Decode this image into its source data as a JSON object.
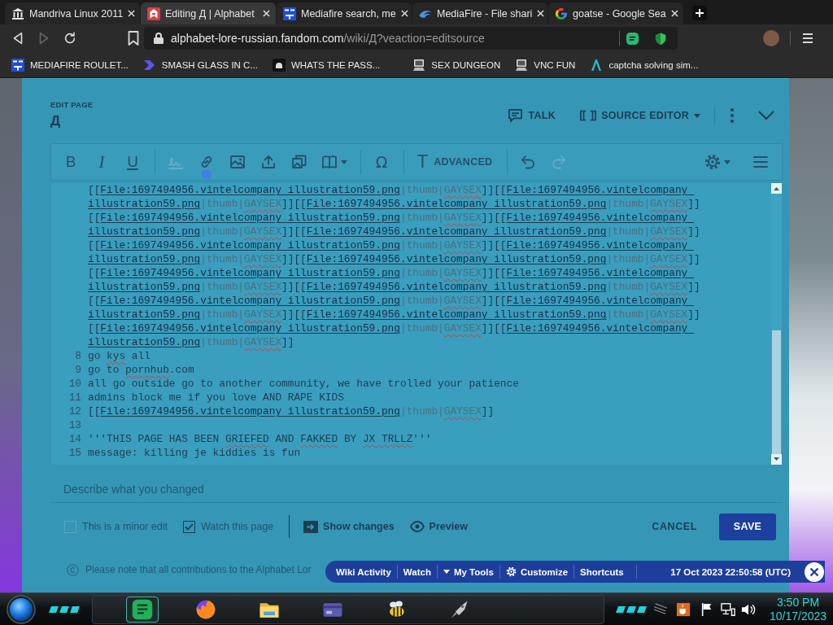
{
  "browser": {
    "tabs": [
      {
        "title": "Mandriva Linux 2011",
        "selected": false
      },
      {
        "title": "Editing Д | Alphabet",
        "selected": true
      },
      {
        "title": "Mediafire search, me",
        "selected": false
      },
      {
        "title": "MediaFire - File shari",
        "selected": false
      },
      {
        "title": "goatse - Google Sea",
        "selected": false
      }
    ],
    "nav": [
      {
        "kind": "back",
        "disabled": false
      },
      {
        "kind": "forward",
        "disabled": true
      },
      {
        "kind": "reload",
        "disabled": false
      }
    ],
    "address": {
      "host": "alphabet-lore-russian.fandom.com",
      "path": "/wiki/Д?veaction=editsource"
    },
    "bookmarks": [
      "MEDIAFIRE ROULET...",
      "SMASH GLASS IN C...",
      "WHATS THE PASS...",
      "SEX DUNGEON",
      "VNC FUN",
      "captcha solving sim..."
    ]
  },
  "editor": {
    "label": "EDIT PAGE",
    "title": "Д",
    "talk": "TALK",
    "mode": "SOURCE EDITOR",
    "toolbar": {
      "groups": [
        {
          "tools": [
            {
              "kind": "bold",
              "label": "B",
              "disabled": false
            },
            {
              "kind": "italic",
              "label": "I",
              "disabled": false
            },
            {
              "kind": "underline",
              "label": "U",
              "disabled": false
            }
          ]
        },
        {
          "tools": [
            {
              "kind": "signature",
              "disabled": true
            },
            {
              "kind": "link",
              "disabled": false
            },
            {
              "kind": "image",
              "disabled": false
            },
            {
              "kind": "upload",
              "disabled": false
            },
            {
              "kind": "gallery",
              "disabled": false
            },
            {
              "kind": "cite",
              "disabled": false
            }
          ]
        },
        {
          "tools": [
            {
              "kind": "special",
              "label": "Ω",
              "disabled": false
            }
          ]
        },
        {
          "tools": [
            {
              "kind": "advanced",
              "glyph": "T",
              "label": "ADVANCED",
              "disabled": false
            }
          ]
        },
        {
          "tools": [
            {
              "kind": "undo",
              "disabled": false
            },
            {
              "kind": "redo",
              "disabled": true
            }
          ]
        }
      ],
      "end": [
        {
          "kind": "settings",
          "disabled": false
        },
        {
          "kind": "menu",
          "disabled": false
        }
      ]
    },
    "code": {
      "lines": [
        {
          "segments": [
            {
              "kind": "bracket",
              "text": "[[",
              "misspelled": false
            },
            {
              "kind": "link",
              "text": "File:1697494956.vintelcompany illustration59.png",
              "misspelled": false
            },
            {
              "kind": "param",
              "text": "|thumb|",
              "misspelled": false
            },
            {
              "kind": "param",
              "text": "GAYSEX",
              "misspelled": true
            },
            {
              "kind": "bracket",
              "text": "]]",
              "misspelled": false
            },
            {
              "kind": "bracket",
              "text": "[[",
              "misspelled": false
            },
            {
              "kind": "link",
              "text": "File:1697494956.vintelcompany illustration59.png",
              "misspelled": false
            },
            {
              "kind": "param",
              "text": "|thumb|",
              "misspelled": false
            },
            {
              "kind": "param",
              "text": "GAYSEX",
              "misspelled": true
            },
            {
              "kind": "bracket",
              "text": "]]",
              "misspelled": false
            },
            {
              "kind": "bracket",
              "text": "[[",
              "misspelled": false
            },
            {
              "kind": "link",
              "text": "File:1697494956.vintelcompany illustration59.png",
              "misspelled": false
            },
            {
              "kind": "param",
              "text": "|thumb|",
              "misspelled": false
            },
            {
              "kind": "param",
              "text": "GAYSEX",
              "misspelled": true
            },
            {
              "kind": "bracket",
              "text": "]]",
              "misspelled": false
            },
            {
              "kind": "bracket",
              "text": "[[",
              "misspelled": false
            },
            {
              "kind": "link",
              "text": "File:1697494956.vintelcompany illustration59.png",
              "misspelled": false
            },
            {
              "kind": "param",
              "text": "|thumb|",
              "misspelled": false
            },
            {
              "kind": "param",
              "text": "GAYSEX",
              "misspelled": true
            },
            {
              "kind": "bracket",
              "text": "]]",
              "misspelled": false
            },
            {
              "kind": "bracket",
              "text": "[[",
              "misspelled": false
            },
            {
              "kind": "link",
              "text": "File:1697494956.vintelcompany illustration59.png",
              "misspelled": false
            },
            {
              "kind": "param",
              "text": "|thumb|",
              "misspelled": false
            },
            {
              "kind": "param",
              "text": "GAYSEX",
              "misspelled": true
            },
            {
              "kind": "bracket",
              "text": "]]",
              "misspelled": false
            },
            {
              "kind": "bracket",
              "text": "[[",
              "misspelled": false
            },
            {
              "kind": "link",
              "text": "File:1697494956.vintelcompany illustration59.png",
              "misspelled": false
            },
            {
              "kind": "param",
              "text": "|thumb|",
              "misspelled": false
            },
            {
              "kind": "param",
              "text": "GAYSEX",
              "misspelled": true
            },
            {
              "kind": "bracket",
              "text": "]]",
              "misspelled": false
            },
            {
              "kind": "bracket",
              "text": "[[",
              "misspelled": false
            },
            {
              "kind": "link",
              "text": "File:1697494956.vintelcompany illustration59.png",
              "misspelled": false
            },
            {
              "kind": "param",
              "text": "|thumb|",
              "misspelled": false
            },
            {
              "kind": "param",
              "text": "GAYSEX",
              "misspelled": true
            },
            {
              "kind": "bracket",
              "text": "]]",
              "misspelled": false
            },
            {
              "kind": "bracket",
              "text": "[[",
              "misspelled": false
            },
            {
              "kind": "link",
              "text": "File:1697494956.vintelcompany illustration59.png",
              "misspelled": false
            },
            {
              "kind": "param",
              "text": "|thumb|",
              "misspelled": false
            },
            {
              "kind": "param",
              "text": "GAYSEX",
              "misspelled": true
            },
            {
              "kind": "bracket",
              "text": "]]",
              "misspelled": false
            },
            {
              "kind": "bracket",
              "text": "[[",
              "misspelled": false
            },
            {
              "kind": "link",
              "text": "File:1697494956.vintelcompany illustration59.png",
              "misspelled": false
            },
            {
              "kind": "param",
              "text": "|thumb|",
              "misspelled": false
            },
            {
              "kind": "param",
              "text": "GAYSEX",
              "misspelled": true
            },
            {
              "kind": "bracket",
              "text": "]]",
              "misspelled": false
            },
            {
              "kind": "bracket",
              "text": "[[",
              "misspelled": false
            },
            {
              "kind": "link",
              "text": "File:1697494956.vintelcompany illustration59.png",
              "misspelled": false
            },
            {
              "kind": "param",
              "text": "|thumb|",
              "misspelled": false
            },
            {
              "kind": "param",
              "text": "GAYSEX",
              "misspelled": true
            },
            {
              "kind": "bracket",
              "text": "]]",
              "misspelled": false
            },
            {
              "kind": "bracket",
              "text": "[[",
              "misspelled": false
            },
            {
              "kind": "link",
              "text": "File:1697494956.vintelcompany illustration59.png",
              "misspelled": false
            },
            {
              "kind": "param",
              "text": "|thumb|",
              "misspelled": false
            },
            {
              "kind": "param",
              "text": "GAYSEX",
              "misspelled": true
            },
            {
              "kind": "bracket",
              "text": "]]",
              "misspelled": false
            },
            {
              "kind": "bracket",
              "text": "[[",
              "misspelled": false
            },
            {
              "kind": "link",
              "text": "File:1697494956.vintelcompany illustration59.png",
              "misspelled": false
            },
            {
              "kind": "param",
              "text": "|thumb|",
              "misspelled": false
            },
            {
              "kind": "param",
              "text": "GAYSEX",
              "misspelled": true
            },
            {
              "kind": "bracket",
              "text": "]]",
              "misspelled": false
            },
            {
              "kind": "bracket",
              "text": "[[",
              "misspelled": false
            },
            {
              "kind": "link",
              "text": "File:1697494956.vintelcompany illustration59.png",
              "misspelled": false
            },
            {
              "kind": "param",
              "text": "|thumb|",
              "misspelled": false
            },
            {
              "kind": "param",
              "text": "GAYSEX",
              "misspelled": true
            },
            {
              "kind": "bracket",
              "text": "]]",
              "misspelled": false
            },
            {
              "kind": "bracket",
              "text": "[[",
              "misspelled": false
            },
            {
              "kind": "link",
              "text": "File:1697494956.vintelcompany illustration59.png",
              "misspelled": false
            },
            {
              "kind": "param",
              "text": "|thumb|",
              "misspelled": false
            },
            {
              "kind": "param",
              "text": "GAYSEX",
              "misspelled": true
            },
            {
              "kind": "bracket",
              "text": "]]",
              "misspelled": false
            },
            {
              "kind": "bracket",
              "text": "[[",
              "misspelled": false
            },
            {
              "kind": "link",
              "text": "File:1697494956.vintelcompany illustration59.png",
              "misspelled": false
            },
            {
              "kind": "param",
              "text": "|thumb|",
              "misspelled": false
            },
            {
              "kind": "param",
              "text": "GAYSEX",
              "misspelled": true
            },
            {
              "kind": "bracket",
              "text": "]]",
              "misspelled": false
            },
            {
              "kind": "bracket",
              "text": "[[",
              "misspelled": false
            },
            {
              "kind": "link",
              "text": "File:1697494956.vintelcompany illustration59.png",
              "misspelled": false
            },
            {
              "kind": "param",
              "text": "|thumb|",
              "misspelled": false
            },
            {
              "kind": "param",
              "text": "GAYSEX",
              "misspelled": true
            },
            {
              "kind": "bracket",
              "text": "]]",
              "misspelled": false
            },
            {
              "kind": "bracket",
              "text": "[[",
              "misspelled": false
            },
            {
              "kind": "link",
              "text": "File:1697494956.vintelcompany illustration59.png",
              "misspelled": false
            },
            {
              "kind": "param",
              "text": "|thumb|",
              "misspelled": false
            },
            {
              "kind": "param",
              "text": "GAYSEX",
              "misspelled": true
            },
            {
              "kind": "bracket",
              "text": "]]",
              "misspelled": false
            }
          ]
        },
        {
          "number": "8",
          "segments": [
            {
              "kind": "plain",
              "text": "go ",
              "misspelled": false
            },
            {
              "kind": "plain",
              "text": "kys",
              "misspelled": true
            },
            {
              "kind": "plain",
              "text": " all",
              "misspelled": false
            }
          ]
        },
        {
          "number": "9",
          "segments": [
            {
              "kind": "plain",
              "text": "go to ",
              "misspelled": false
            },
            {
              "kind": "plain",
              "text": "pornhub",
              "misspelled": true
            },
            {
              "kind": "plain",
              "text": ".com",
              "misspelled": false
            }
          ]
        },
        {
          "number": "10",
          "segments": [
            {
              "kind": "plain",
              "text": "all go outside go to another community, we have trolled your patience",
              "misspelled": false
            }
          ]
        },
        {
          "number": "11",
          "segments": [
            {
              "kind": "plain",
              "text": "admins block me if you love AND RAPE KIDS",
              "misspelled": false
            }
          ]
        },
        {
          "number": "12",
          "segments": [
            {
              "kind": "bracket",
              "text": "[[",
              "misspelled": false
            },
            {
              "kind": "link",
              "text": "File:1697494956.vintelcompany illustration59.png",
              "misspelled": false
            },
            {
              "kind": "param",
              "text": "|thumb|",
              "misspelled": false
            },
            {
              "kind": "param",
              "text": "GAYSEX",
              "misspelled": true
            },
            {
              "kind": "bracket",
              "text": "]]",
              "misspelled": false
            }
          ]
        },
        {
          "number": "13"
        },
        {
          "number": "14",
          "segments": [
            {
              "kind": "plain",
              "text": "'''THIS PAGE HAS BEEN ",
              "misspelled": false
            },
            {
              "kind": "plain",
              "text": "GRIEFED",
              "misspelled": true
            },
            {
              "kind": "plain",
              "text": " AND ",
              "misspelled": false
            },
            {
              "kind": "plain",
              "text": "FAKKED",
              "misspelled": true
            },
            {
              "kind": "plain",
              "text": " BY ",
              "misspelled": false
            },
            {
              "kind": "plain",
              "text": "JX",
              "misspelled": true
            },
            {
              "kind": "plain",
              "text": " TRLLZ",
              "misspelled": true
            },
            {
              "kind": "plain",
              "text": "'''",
              "misspelled": false
            }
          ]
        },
        {
          "number": "15",
          "segments": [
            {
              "kind": "plain",
              "text": "message: killing je kiddies is fun",
              "misspelled": false
            }
          ]
        }
      ]
    },
    "summary": {
      "placeholder": "Describe what you changed"
    },
    "options": [
      {
        "label": "This is a minor edit",
        "checked": false
      },
      {
        "label": "Watch this page",
        "checked": true
      }
    ],
    "show_changes": "Show changes",
    "preview": "Preview",
    "cancel": "CANCEL",
    "save": "SAVE",
    "notice": "Please note that all contributions to the Alphabet Lor"
  },
  "fandom_bar": {
    "items": [
      {
        "kind": "link",
        "label": "Wiki Activity"
      },
      {
        "kind": "link",
        "label": "Watch"
      },
      {
        "kind": "menu",
        "label": "My Tools"
      },
      {
        "kind": "settings",
        "label": "Customize"
      },
      {
        "kind": "link",
        "label": "Shortcuts"
      }
    ],
    "timestamp": "17 Oct 2023 22:50:58 (UTC)"
  },
  "taskbar": {
    "apps": [
      {
        "selected": true
      },
      {
        "selected": false
      },
      {
        "selected": false
      },
      {
        "selected": false
      },
      {
        "selected": false
      },
      {
        "selected": false
      }
    ],
    "clock": {
      "time": "3:50 PM",
      "date": "10/17/2023"
    }
  }
}
